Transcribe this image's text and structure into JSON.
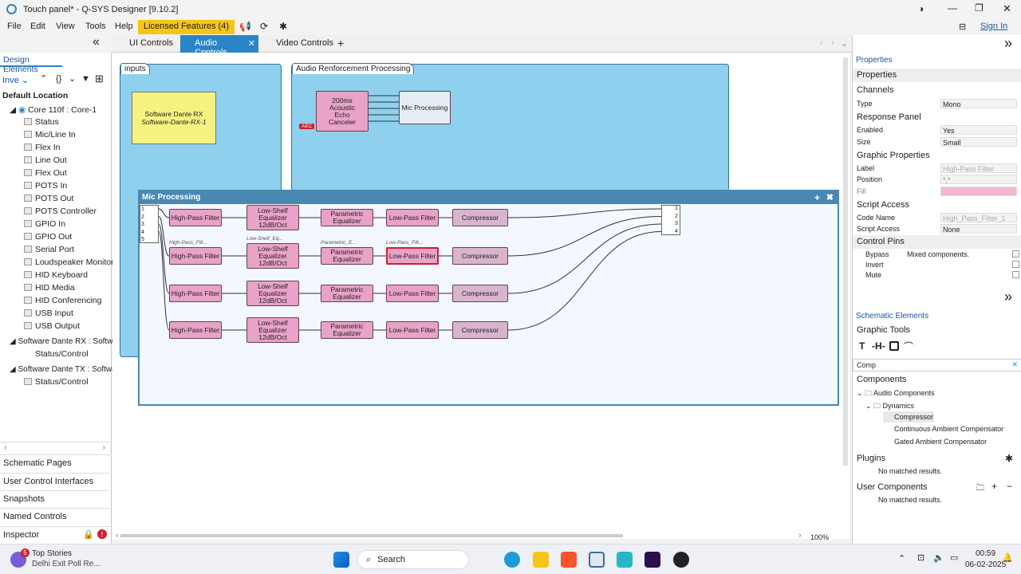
{
  "window": {
    "title": "Touch panel* - Q-SYS Designer [9.10.2]",
    "sign_in": "Sign In"
  },
  "menu": {
    "items": [
      "File",
      "Edit",
      "View",
      "Tools",
      "Help"
    ],
    "licensed": "Licensed Features (4)"
  },
  "tabs": [
    {
      "label": "UI Controls"
    },
    {
      "label": "Audio Controls"
    },
    {
      "label": "Video Controls"
    }
  ],
  "left": {
    "header": "Design Elements",
    "filter": "Inve",
    "root": "Default Location",
    "core": "Core 110f : Core-1",
    "core_items": [
      "Status",
      "Mic/Line In",
      "Flex In",
      "Line Out",
      "Flex Out",
      "POTS In",
      "POTS Out",
      "POTS Controller",
      "GPIO In",
      "GPIO Out",
      "Serial Port",
      "Loudspeaker Monitor",
      "HID Keyboard",
      "HID Media",
      "HID Conferencing",
      "USB Input",
      "USB Output"
    ],
    "dante_rx": "Software Dante RX : Softwar",
    "dante_rx_child": "Status/Control",
    "dante_tx": "Software Dante TX : Softwar",
    "dante_tx_child": "Status/Control",
    "nav": [
      "Schematic Pages",
      "User Control Interfaces",
      "Snapshots",
      "Named Controls",
      "Inspector"
    ]
  },
  "canvas": {
    "inputs_title": "inputs",
    "arp_title": "Audio Renforcement Processing",
    "dante_line1": "Software Dante RX",
    "dante_line2": "Software-Dante-RX-1",
    "aec_lines": [
      "200ms",
      "Acoustic",
      "Echo",
      "Canceler"
    ],
    "aec_tag": "AEC",
    "mic_block": "Mic Processing",
    "micproc_title": "Mic Processing",
    "hpf": "High-Pass Filter",
    "lsf": "Low-Shelf Equalizer 12dB/Oct",
    "peq": "Parametric Equalizer",
    "lpf": "Low-Pass Filter",
    "comp": "Compressor",
    "row2_labels": [
      "High-Pass_Filt...",
      "Low-Shelf_Eq...",
      "Parametric_E...",
      "Low-Pass_Filt..."
    ],
    "in_ports": [
      "1",
      "2",
      "3",
      "4",
      "5"
    ],
    "out_ports": [
      "1",
      "2",
      "3",
      "4"
    ],
    "zoom": "100%"
  },
  "right": {
    "properties_tab": "Properties",
    "properties": "Properties",
    "channels": "Channels",
    "type_k": "Type",
    "type_v": "Mono",
    "response_panel": "Response Panel",
    "enabled_k": "Enabled",
    "enabled_v": "Yes",
    "size_k": "Size",
    "size_v": "Small",
    "graphic_props": "Graphic Properties",
    "label_k": "Label",
    "label_v": "High-Pass Filter",
    "position_k": "Position",
    "position_v": "*,*",
    "fill_k": "Fill",
    "script_access": "Script Access",
    "codename_k": "Code Name",
    "codename_v": "High_Pass_Filter_1",
    "sa_k": "Script Access",
    "sa_v": "None",
    "control_pins": "Control Pins",
    "pins": [
      "Bypass",
      "Invert",
      "Mute"
    ],
    "mixed": "Mixed components.",
    "schematic_tab": "Schematic Elements",
    "graphic_tools": "Graphic Tools",
    "search": "Comp",
    "components": "Components",
    "audio_components": "Audio Components",
    "dynamics": "Dynamics",
    "comp_results": [
      "Compressor",
      "Continuous Ambient Compensator",
      "Gated Ambient Compensator"
    ],
    "plugins": "Plugins",
    "no_match1": "No matched results.",
    "user_components": "User Components",
    "no_match2": "No matched results."
  },
  "taskbar": {
    "news_title": "Top Stories",
    "news_sub": "Delhi Exit Poll Re...",
    "badge": "5",
    "search": "Search",
    "time": "00:59",
    "date": "06-02-2025"
  },
  "colors": {
    "accent": "#2a85c8",
    "block_fill": "#e9a2c8",
    "canvas_box": "#8fd0ee",
    "license": "#f5c518",
    "selected_border": "#d01f2d"
  }
}
